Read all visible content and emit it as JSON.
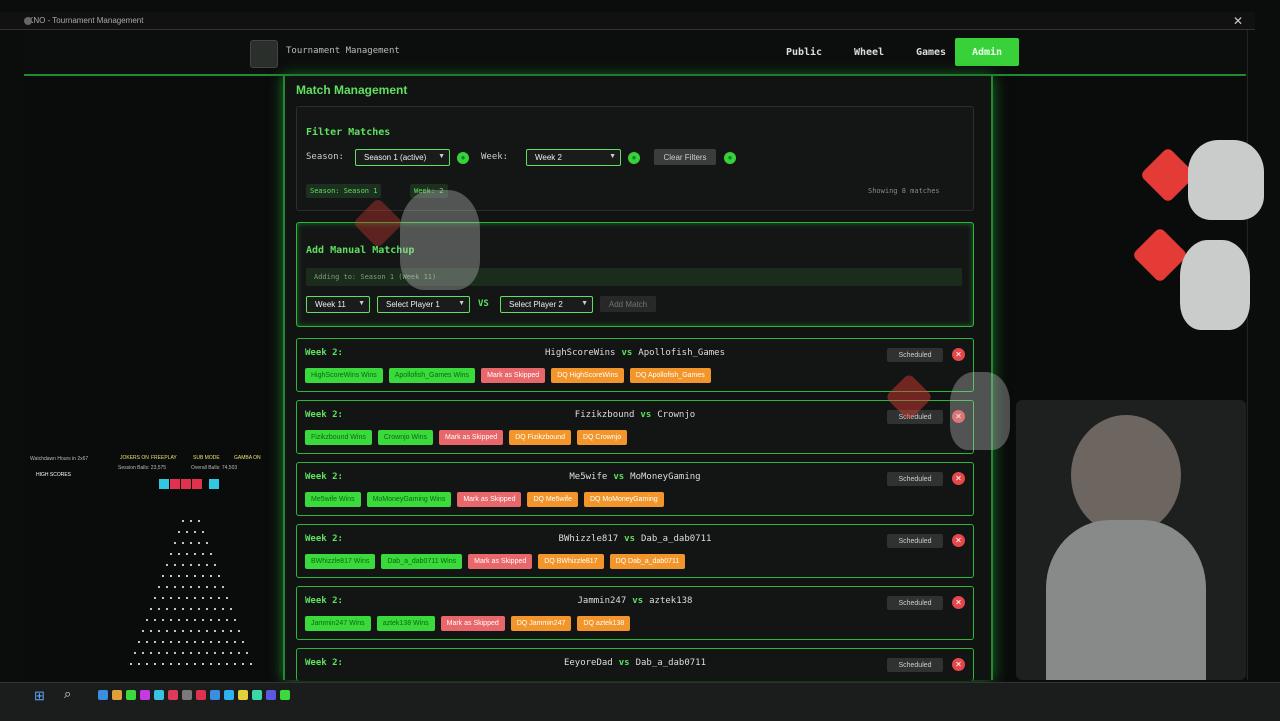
{
  "window": {
    "title": "KNO - Tournament Management"
  },
  "nav": {
    "app_title": "Tournament Management",
    "items": [
      {
        "label": "Public"
      },
      {
        "label": "Wheel"
      },
      {
        "label": "Games"
      },
      {
        "label": "Admin"
      }
    ],
    "active": "Admin"
  },
  "main": {
    "title": "Match Management",
    "filter": {
      "title": "Filter Matches",
      "season_label": "Season:",
      "season_value": "Season 1 (active)",
      "week_label": "Week:",
      "week_value": "Week 2",
      "clear_label": "Clear Filters",
      "active_tags": [
        "Season: Season 1",
        "Week: 2"
      ],
      "showing": "Showing 8 matches"
    },
    "manual": {
      "title": "Add Manual Matchup",
      "adding_to": "Adding to: Season 1 (Week 11)",
      "week_value": "Week 11",
      "player1_placeholder": "Select Player 1",
      "vs": "VS",
      "player2_placeholder": "Select Player 2",
      "add_label": "Add Match"
    },
    "matches": [
      {
        "week": "Week 2:",
        "p1": "HighScoreWins",
        "p2": "Apollofish_Games",
        "status": "Scheduled",
        "win1": "HighScoreWins Wins",
        "win2": "Apollofish_Games Wins",
        "skip": "Mark as Skipped",
        "dq1": "DQ HighScoreWins",
        "dq2": "DQ Apollofish_Games"
      },
      {
        "week": "Week 2:",
        "p1": "Fizikzbound",
        "p2": "Crownjo",
        "status": "Scheduled",
        "win1": "Fizikzbound Wins",
        "win2": "Crownjo Wins",
        "skip": "Mark as Skipped",
        "dq1": "DQ Fizikzbound",
        "dq2": "DQ Crownjo"
      },
      {
        "week": "Week 2:",
        "p1": "Me5wife",
        "p2": "MoMoneyGaming",
        "status": "Scheduled",
        "win1": "Me5wife Wins",
        "win2": "MoMoneyGaming Wins",
        "skip": "Mark as Skipped",
        "dq1": "DQ Me5wife",
        "dq2": "DQ MoMoneyGaming"
      },
      {
        "week": "Week 2:",
        "p1": "BWhizzle817",
        "p2": "Dab_a_dab0711",
        "status": "Scheduled",
        "win1": "BWhizzle817 Wins",
        "win2": "Dab_a_dab0711 Wins",
        "skip": "Mark as Skipped",
        "dq1": "DQ BWhizzle817",
        "dq2": "DQ Dab_a_dab0711"
      },
      {
        "week": "Week 2:",
        "p1": "Jammin247",
        "p2": "aztek138",
        "status": "Scheduled",
        "win1": "Jammin247 Wins",
        "win2": "aztek138 Wins",
        "skip": "Mark as Skipped",
        "dq1": "DQ Jammin247",
        "dq2": "DQ aztek138"
      },
      {
        "week": "Week 2:",
        "p1": "EeyoreDad",
        "p2": "Dab_a_dab0711",
        "status": "Scheduled"
      }
    ]
  },
  "overlay": {
    "title": "Watchdawn Hours in 2x67",
    "high_scores": "HIGH SCORES",
    "stats": [
      "JOKERS ON",
      "FREEPLAY",
      "SUB MODE",
      "GAMBA ON"
    ],
    "session_balls": "Session Balls: 23,575",
    "overall_balls": "Overall Balls: 74,503"
  },
  "colors": {
    "accent_green": "#39d13a",
    "skip_red": "#e8676a",
    "dq_orange": "#f2962c",
    "delete_red": "#e5474a"
  }
}
